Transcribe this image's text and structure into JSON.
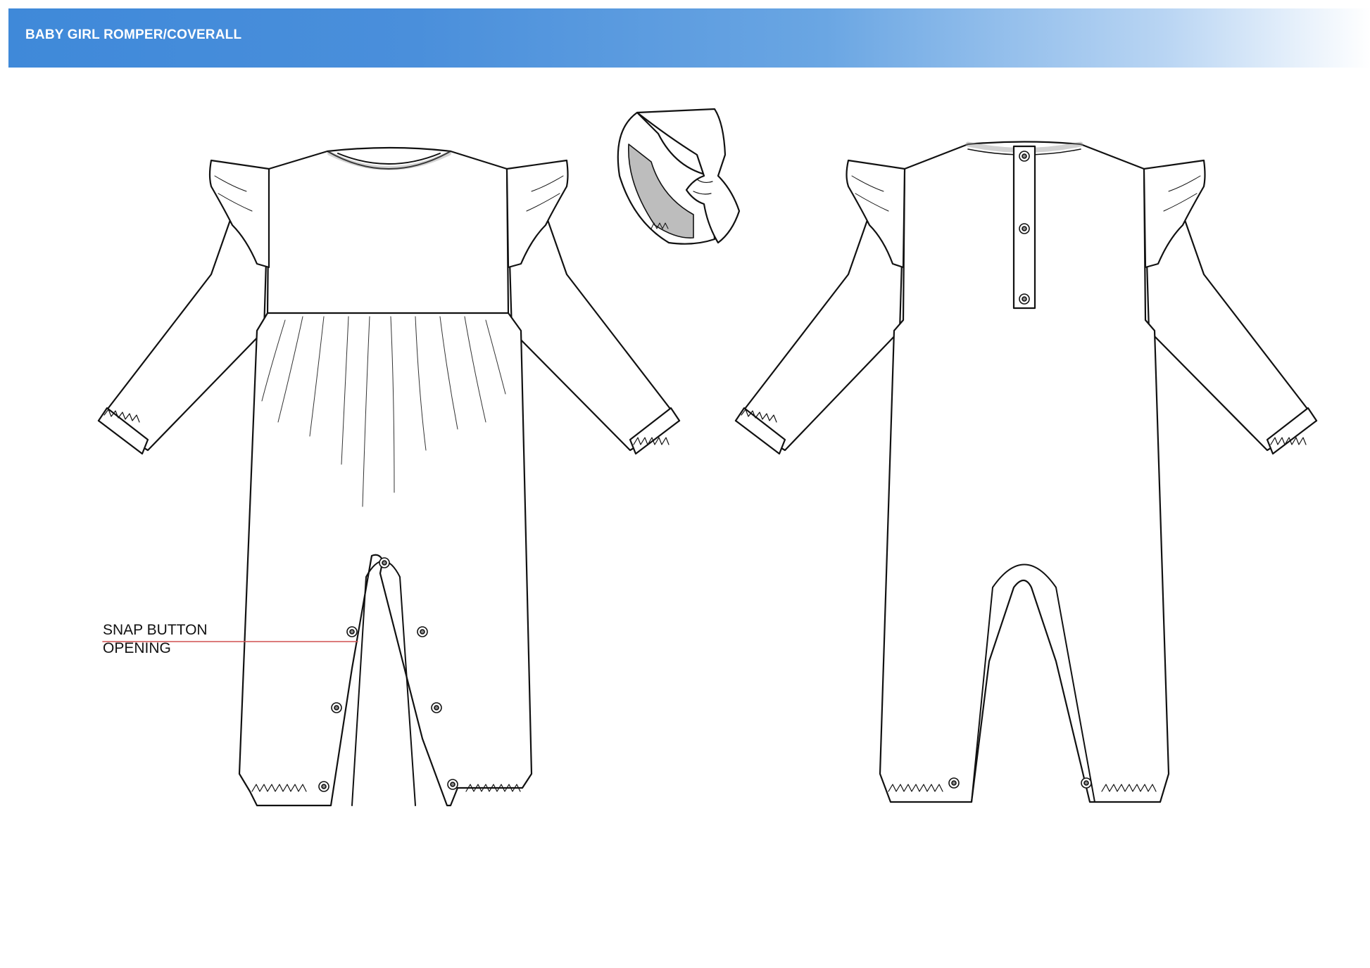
{
  "header": {
    "title": "BABY GIRL ROMPER/COVERALL",
    "gradient_start": "#3f89d9",
    "gradient_end": "#ffffff"
  },
  "callout": {
    "line1": "SNAP BUTTON",
    "line2": "OPENING",
    "leader_color": "#d05050"
  },
  "views": [
    "front-view",
    "back-view",
    "headband"
  ]
}
